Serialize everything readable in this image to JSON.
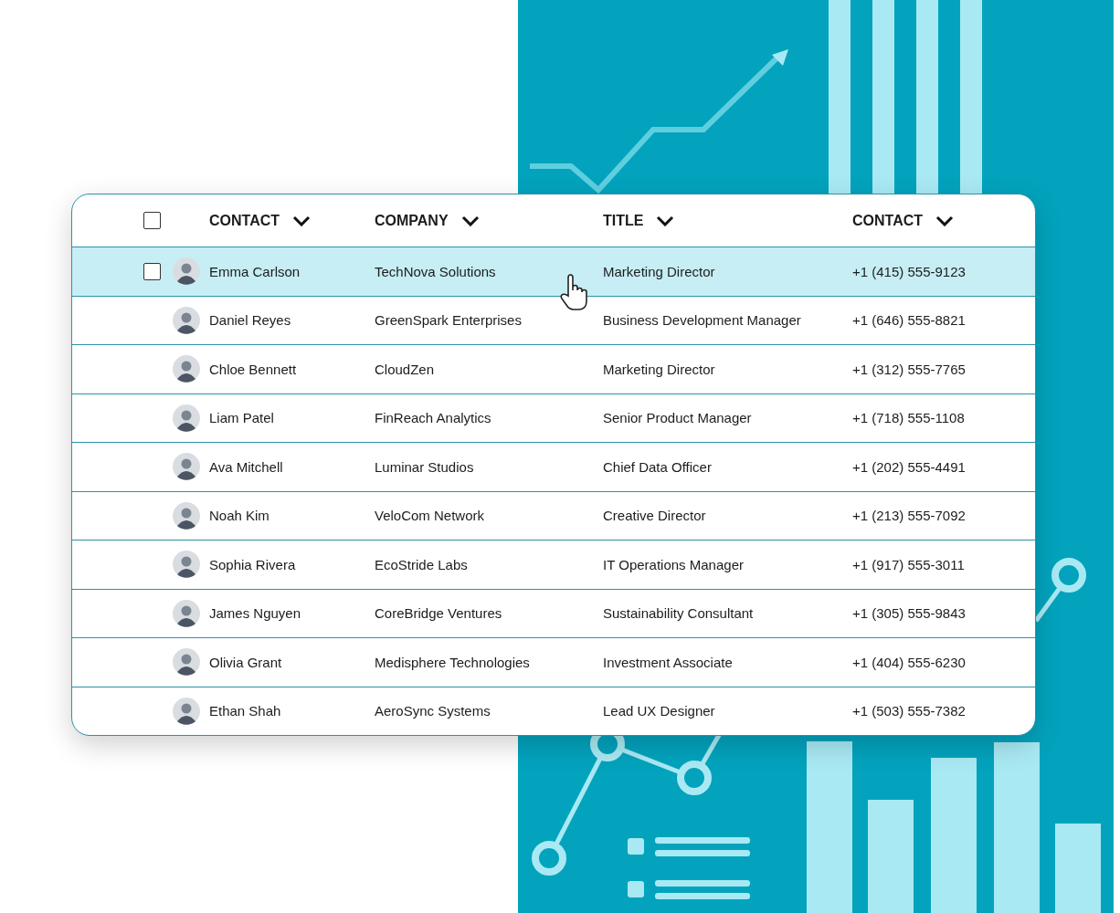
{
  "table": {
    "header_checkbox": {
      "checked": false
    },
    "columns": [
      {
        "label": "CONTACT"
      },
      {
        "label": "COMPANY"
      },
      {
        "label": "TITLE"
      },
      {
        "label": "CONTACT"
      }
    ],
    "rows": [
      {
        "name": "Emma Carlson",
        "company": "TechNova Solutions",
        "title": "Marketing Director",
        "phone": "+1 (415) 555-9123",
        "selected": true
      },
      {
        "name": "Daniel Reyes",
        "company": "GreenSpark Enterprises",
        "title": "Business Development Manager",
        "phone": "+1 (646) 555-8821",
        "selected": false
      },
      {
        "name": "Chloe Bennett",
        "company": "CloudZen",
        "title": "Marketing Director",
        "phone": "+1 (312) 555-7765",
        "selected": false
      },
      {
        "name": "Liam Patel",
        "company": "FinReach Analytics",
        "title": "Senior Product Manager",
        "phone": "+1 (718) 555-1108",
        "selected": false
      },
      {
        "name": "Ava Mitchell",
        "company": "Luminar Studios",
        "title": "Chief Data Officer",
        "phone": "+1 (202) 555-4491",
        "selected": false
      },
      {
        "name": "Noah Kim",
        "company": "VeloCom Network",
        "title": "Creative Director",
        "phone": "+1 (213) 555-7092",
        "selected": false
      },
      {
        "name": "Sophia Rivera",
        "company": "EcoStride Labs",
        "title": "IT Operations Manager",
        "phone": "+1 (917) 555-3011",
        "selected": false
      },
      {
        "name": "James Nguyen",
        "company": "CoreBridge Ventures",
        "title": "Sustainability Consultant",
        "phone": "+1 (305) 555-9843",
        "selected": false
      },
      {
        "name": "Olivia Grant",
        "company": "Medisphere Technologies",
        "title": "Investment Associate",
        "phone": "+1 (404) 555-6230",
        "selected": false
      },
      {
        "name": "Ethan Shah",
        "company": "AeroSync Systems",
        "title": "Lead UX Designer",
        "phone": "+1 (503) 555-7382",
        "selected": false
      }
    ]
  }
}
